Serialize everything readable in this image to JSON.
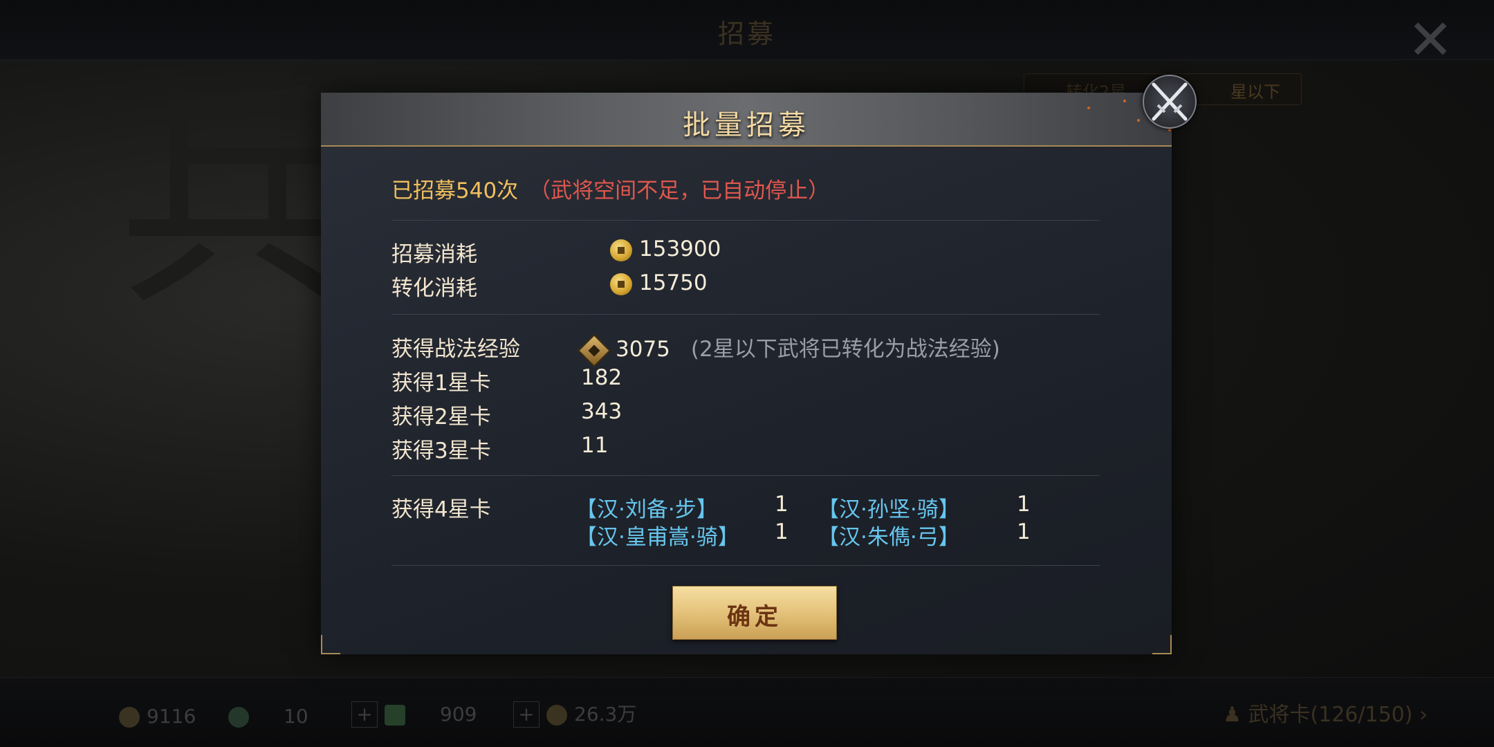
{
  "background": {
    "title": "招募",
    "tag_text": "转化2星",
    "tag_right": "星以下",
    "resources": [
      "9116",
      "10",
      "909",
      "26.3万"
    ],
    "general_cards": "武将卡(126/150)"
  },
  "dialog": {
    "title": "批量招募",
    "status_done": "已招募540次",
    "status_warn": "（武将空间不足，已自动停止）",
    "costs": [
      {
        "label": "招募消耗",
        "value": "153900",
        "icon": "copper-coin-icon"
      },
      {
        "label": "转化消耗",
        "value": "15750",
        "icon": "copper-coin-icon"
      }
    ],
    "skill_exp": {
      "label": "获得战法经验",
      "value": "3075",
      "note": "(2星以下武将已转化为战法经验)",
      "icon": "skill-exp-icon"
    },
    "cards": [
      {
        "label": "获得1星卡",
        "value": "182"
      },
      {
        "label": "获得2星卡",
        "value": "343"
      },
      {
        "label": "获得3星卡",
        "value": "11"
      }
    ],
    "four_star": {
      "label": "获得4星卡",
      "heroes": [
        {
          "name": "【汉·刘备·步】",
          "count": "1"
        },
        {
          "name": "【汉·孙坚·骑】",
          "count": "1"
        },
        {
          "name": "【汉·皇甫嵩·骑】",
          "count": "1"
        },
        {
          "name": "【汉·朱儁·弓】",
          "count": "1"
        }
      ]
    },
    "confirm_label": "确定"
  },
  "colors": {
    "accent_gold": "#f0c05e",
    "warning_red": "#e0574e",
    "hero_blue": "#67c6ee",
    "button_gold": "#e4c27a"
  }
}
